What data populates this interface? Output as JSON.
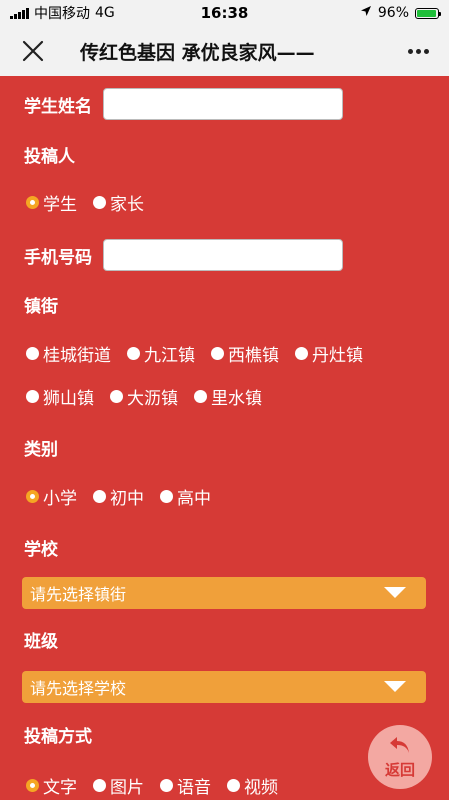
{
  "status": {
    "carrier": "中国移动",
    "network": "4G",
    "time": "16:38",
    "battery": "96%",
    "battery_level": 0.96
  },
  "nav": {
    "title": "传红色基因 承优良家风——"
  },
  "form": {
    "student_name_label": "学生姓名",
    "student_name_value": "",
    "submitter_label": "投稿人",
    "submitter_options": [
      "学生",
      "家长"
    ],
    "submitter_selected": "学生",
    "phone_label": "手机号码",
    "phone_value": "",
    "town_label": "镇街",
    "town_options": [
      "桂城街道",
      "九江镇",
      "西樵镇",
      "丹灶镇",
      "狮山镇",
      "大沥镇",
      "里水镇"
    ],
    "category_label": "类别",
    "category_options": [
      "小学",
      "初中",
      "高中"
    ],
    "category_selected": "小学",
    "school_label": "学校",
    "school_select": "请先选择镇街",
    "class_label": "班级",
    "class_select": "请先选择学校",
    "method_label": "投稿方式",
    "method_options": [
      "文字",
      "图片",
      "语音",
      "视频"
    ],
    "method_selected": "文字"
  },
  "back_button": {
    "label": "返回"
  },
  "colors": {
    "background": "#d63a36",
    "select": "#f0a03a",
    "radio_checked": "#f5a623",
    "bar": "#f2f2f2"
  },
  "icons": {
    "close": "close-icon",
    "more": "more-icon",
    "back": "back-arrow-icon"
  }
}
